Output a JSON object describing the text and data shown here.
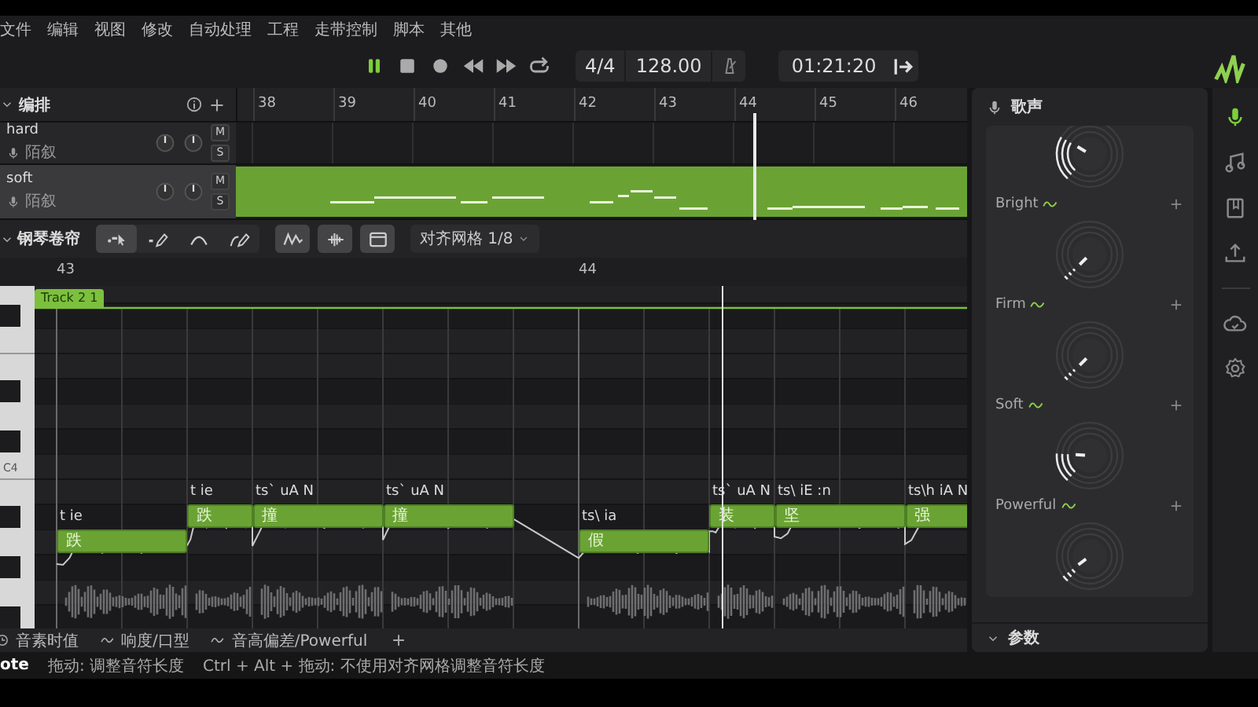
{
  "menu": [
    "文件",
    "编辑",
    "视图",
    "修改",
    "自动处理",
    "工程",
    "走带控制",
    "脚本",
    "其他"
  ],
  "transport": {
    "playing": true,
    "time_signature": "4/4",
    "tempo": "128.00",
    "time": "01:21:20"
  },
  "arrangement": {
    "title": "编排",
    "ruler": [
      "38",
      "39",
      "40",
      "41",
      "42",
      "43",
      "44",
      "45",
      "46"
    ],
    "tracks": [
      {
        "name": "hard",
        "singer": "陌叙",
        "mute": "M",
        "solo": "S",
        "selected": false
      },
      {
        "name": "soft",
        "singer": "陌叙",
        "mute": "M",
        "solo": "S",
        "selected": true
      }
    ]
  },
  "piano_roll": {
    "title": "钢琴卷帘",
    "tools": [
      {
        "kind": "select",
        "selected": true
      },
      {
        "kind": "draw",
        "selected": false
      },
      {
        "kind": "curve",
        "selected": false
      },
      {
        "kind": "pitch-draw",
        "selected": false
      }
    ],
    "toggles": [
      {
        "kind": "pitch",
        "on": true
      },
      {
        "kind": "waveform",
        "on": true
      },
      {
        "kind": "panel",
        "on": true
      }
    ],
    "snap": "对齐网格 1/8",
    "ruler": [
      "43",
      "44"
    ],
    "region": "Track 2 1",
    "key_label": "C4",
    "notes": [
      {
        "lyric": "跌",
        "phoneme": "t ie"
      },
      {
        "lyric": "跌",
        "phoneme": "t ie"
      },
      {
        "lyric": "撞",
        "phoneme": "ts` uA N"
      },
      {
        "lyric": "撞",
        "phoneme": "ts` uA N"
      },
      {
        "lyric": "假",
        "phoneme": "ts\\ ia"
      },
      {
        "lyric": "装",
        "phoneme": "ts` uA N"
      },
      {
        "lyric": "坚",
        "phoneme": "ts\\ iE :n"
      },
      {
        "lyric": "强",
        "phoneme": "ts\\h iA N"
      }
    ],
    "param_tabs": [
      "音素时值",
      "响度/口型",
      "音高偏差/Powerful"
    ]
  },
  "voice": {
    "title": "歌声",
    "knobs": [
      {
        "kind": "plain"
      },
      {
        "kind": "labeled",
        "label": "Bright"
      },
      {
        "kind": "labeled",
        "label": "Firm"
      },
      {
        "kind": "labeled",
        "label": "Soft"
      },
      {
        "kind": "labeled",
        "label": "Powerful"
      }
    ],
    "params_title": "参数"
  },
  "sidebar": {
    "items": [
      {
        "kind": "mic",
        "selected": true
      },
      {
        "kind": "music",
        "selected": false
      },
      {
        "kind": "book",
        "selected": false
      },
      {
        "kind": "upload",
        "selected": false
      },
      {
        "kind": "cloud",
        "selected": false
      },
      {
        "kind": "gear",
        "selected": false
      }
    ]
  },
  "status_bar": [
    "ote",
    "拖动: 调整音符长度",
    "Ctrl + Alt + 拖动: 不使用对齐网格调整音符长度"
  ]
}
